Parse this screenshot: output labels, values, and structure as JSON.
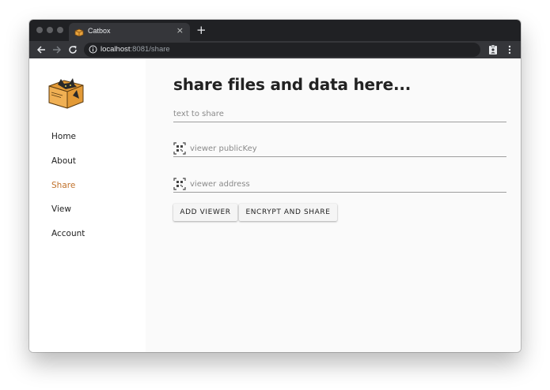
{
  "browser": {
    "tab_title": "Catbox",
    "tab_close": "×",
    "new_tab": "+",
    "url_host": "localhost",
    "url_rest": ":8081/share",
    "icons": [
      "back-arrow-icon",
      "forward-arrow-icon",
      "reload-icon",
      "info-icon",
      "extension-icon",
      "kebab-menu-icon",
      "catbox-favicon-icon"
    ]
  },
  "sidebar": {
    "logo": "catbox-logo",
    "items": [
      {
        "label": "Home",
        "active": false
      },
      {
        "label": "About",
        "active": false
      },
      {
        "label": "Share",
        "active": true
      },
      {
        "label": "View",
        "active": false
      },
      {
        "label": "Account",
        "active": false
      }
    ],
    "active_color": "#c0712b"
  },
  "main": {
    "title": "share files and data here...",
    "fields": {
      "text_placeholder": "text to share",
      "publickey_placeholder": "viewer publicKey",
      "address_placeholder": "viewer address"
    },
    "buttons": {
      "add_viewer": "ADD VIEWER",
      "encrypt_share": "ENCRYPT AND SHARE"
    }
  }
}
